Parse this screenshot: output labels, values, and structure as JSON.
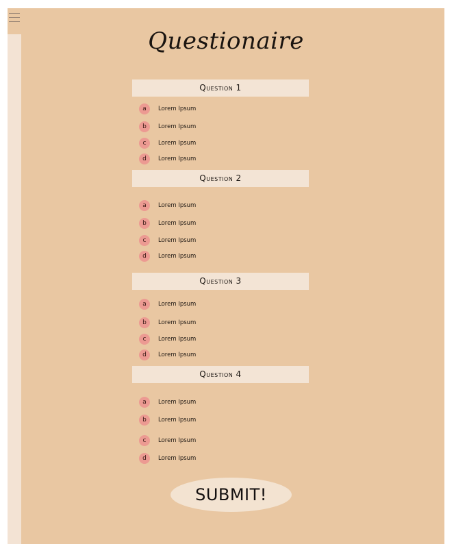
{
  "title": "Questionaire",
  "questions": [
    {
      "label": "Question 1",
      "options": [
        {
          "letter": "a",
          "text": "Lorem Ipsum"
        },
        {
          "letter": "b",
          "text": "Lorem Ipsum"
        },
        {
          "letter": "c",
          "text": "Lorem Ipsum"
        },
        {
          "letter": "d",
          "text": "Lorem Ipsum"
        }
      ]
    },
    {
      "label": "Question 2",
      "options": [
        {
          "letter": "a",
          "text": "Lorem Ipsum"
        },
        {
          "letter": "b",
          "text": "Lorem Ipsum"
        },
        {
          "letter": "c",
          "text": "Lorem Ipsum"
        },
        {
          "letter": "d",
          "text": "Lorem Ipsum"
        }
      ]
    },
    {
      "label": "Question 3",
      "options": [
        {
          "letter": "a",
          "text": "Lorem Ipsum"
        },
        {
          "letter": "b",
          "text": "Lorem Ipsum"
        },
        {
          "letter": "c",
          "text": "Lorem Ipsum"
        },
        {
          "letter": "d",
          "text": "Lorem Ipsum"
        }
      ]
    },
    {
      "label": "Question 4",
      "options": [
        {
          "letter": "a",
          "text": "Lorem Ipsum"
        },
        {
          "letter": "b",
          "text": "Lorem Ipsum"
        },
        {
          "letter": "c",
          "text": "Lorem Ipsum"
        },
        {
          "letter": "d",
          "text": "Lorem Ipsum"
        }
      ]
    }
  ],
  "submit_label": "SUBMIT!",
  "icons": {
    "menu": "hamburger-menu-icon"
  },
  "colors": {
    "background": "#e9c7a2",
    "panel": "#f3e3d4",
    "bullet": "#ec9a92"
  }
}
